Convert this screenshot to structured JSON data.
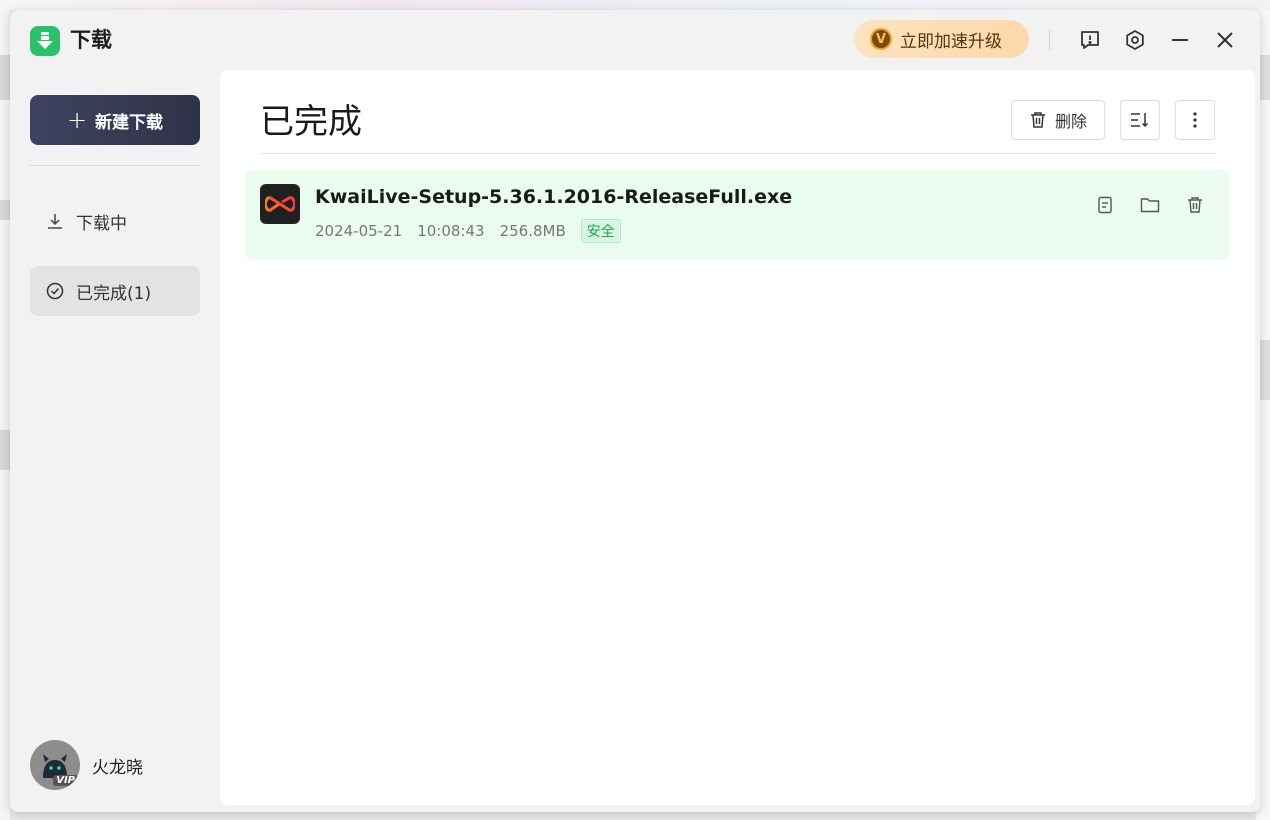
{
  "app": {
    "title": "下载",
    "upgrade_label": "立即加速升级",
    "upgrade_badge": "V"
  },
  "sidebar": {
    "new_download_label": "新建下载",
    "items": [
      {
        "label": "下载中",
        "icon": "download-icon"
      },
      {
        "label": "已完成(1)",
        "icon": "check-circle-icon"
      }
    ],
    "user": {
      "name": "火龙晓",
      "vip": "VIP"
    }
  },
  "main": {
    "title": "已完成",
    "delete_label": "删除",
    "downloads": [
      {
        "name": "KwaiLive-Setup-5.36.1.2016-ReleaseFull.exe",
        "date": "2024-05-21",
        "time": "10:08:43",
        "size": "256.8MB",
        "status": "安全"
      }
    ]
  },
  "colors": {
    "accent_green": "#29c26a",
    "row_bg": "#eafcef",
    "new_button_bg": "#3f4360",
    "upgrade_bg": "#fcd9ab"
  }
}
